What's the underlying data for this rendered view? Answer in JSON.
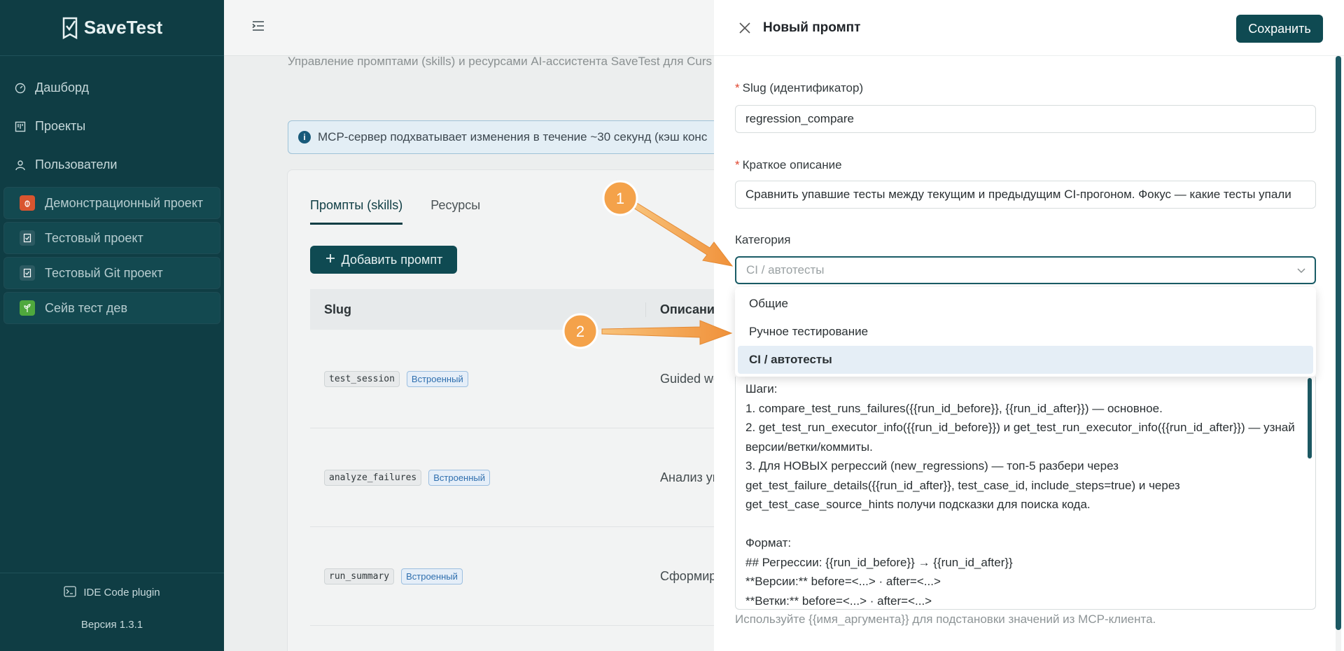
{
  "app": {
    "name": "SaveTest"
  },
  "sidebar": {
    "nav": [
      {
        "label": "Дашборд"
      },
      {
        "label": "Проекты"
      },
      {
        "label": "Пользователи"
      }
    ],
    "projects": [
      {
        "label": "Демонстрационный проект",
        "color": "#d9552f"
      },
      {
        "label": "Тестовый проект",
        "color": "#2c5a62"
      },
      {
        "label": "Тестовый Git проект",
        "color": "#2c5a62"
      },
      {
        "label": "Сейв тест дев",
        "color": "#4fa83d"
      }
    ],
    "plugin_label": "IDE Code plugin",
    "version": "Версия 1.3.1"
  },
  "main": {
    "subtitle": "Управление промптами (skills) и ресурсами AI-ассистента SaveTest для Curs",
    "banner": "MCP-сервер подхватывает изменения в течение ~30 секунд (кэш конс",
    "tabs": [
      {
        "label": "Промпты (skills)"
      },
      {
        "label": "Ресурсы"
      }
    ],
    "add_button": "Добавить промпт",
    "table": {
      "headers": {
        "slug": "Slug",
        "desc": "Описание"
      },
      "rows": [
        {
          "slug": "test_session",
          "badge": "Встроенный",
          "desc": "Guided wo"
        },
        {
          "slug": "analyze_failures",
          "badge": "Встроенный",
          "desc": "Анализ уп"
        },
        {
          "slug": "run_summary",
          "badge": "Встроенный",
          "desc": "Сформиро"
        }
      ]
    }
  },
  "drawer": {
    "title": "Новый промпт",
    "save_label": "Сохранить",
    "slug": {
      "label": "Slug (идентификатор)",
      "value": "regression_compare"
    },
    "short_desc": {
      "label": "Краткое описание",
      "value": "Сравнить упавшие тесты между текущим и предыдущим CI-прогоном. Фокус — какие тесты упали"
    },
    "category": {
      "label": "Категория",
      "placeholder": "CI / автотесты",
      "options": [
        {
          "label": "Общие"
        },
        {
          "label": "Ручное тестирование"
        },
        {
          "label": "CI / автотесты"
        }
      ],
      "selected_index": 2
    },
    "body_lines": [
      "Шаги:",
      "1. compare_test_runs_failures({{run_id_before}}, {{run_id_after}}) — основное.",
      "2. get_test_run_executor_info({{run_id_before}}) и get_test_run_executor_info({{run_id_after}}) — узнай",
      "версии/ветки/коммиты.",
      "3. Для НОВЫХ регрессий (new_regressions) — топ-5 разбери через",
      "get_test_failure_details({{run_id_after}}, test_case_id, include_steps=true) и через",
      "get_test_case_source_hints получи подсказки для поиска кода.",
      "",
      "Формат:",
      "## Регрессии: {{run_id_before}} → {{run_id_after}}",
      "**Версии:** before=<...> · after=<...>",
      "**Ветки:** before=<...> · after=<...>"
    ],
    "hint": "Используйте {{имя_аргумента}} для подстановки значений из MCP-клиента."
  },
  "annotations": [
    {
      "label": "1"
    },
    {
      "label": "2"
    }
  ],
  "colors": {
    "accent": "#0f4a52",
    "sidebar": "#0f3d44",
    "annotation": "#f4a24a"
  }
}
